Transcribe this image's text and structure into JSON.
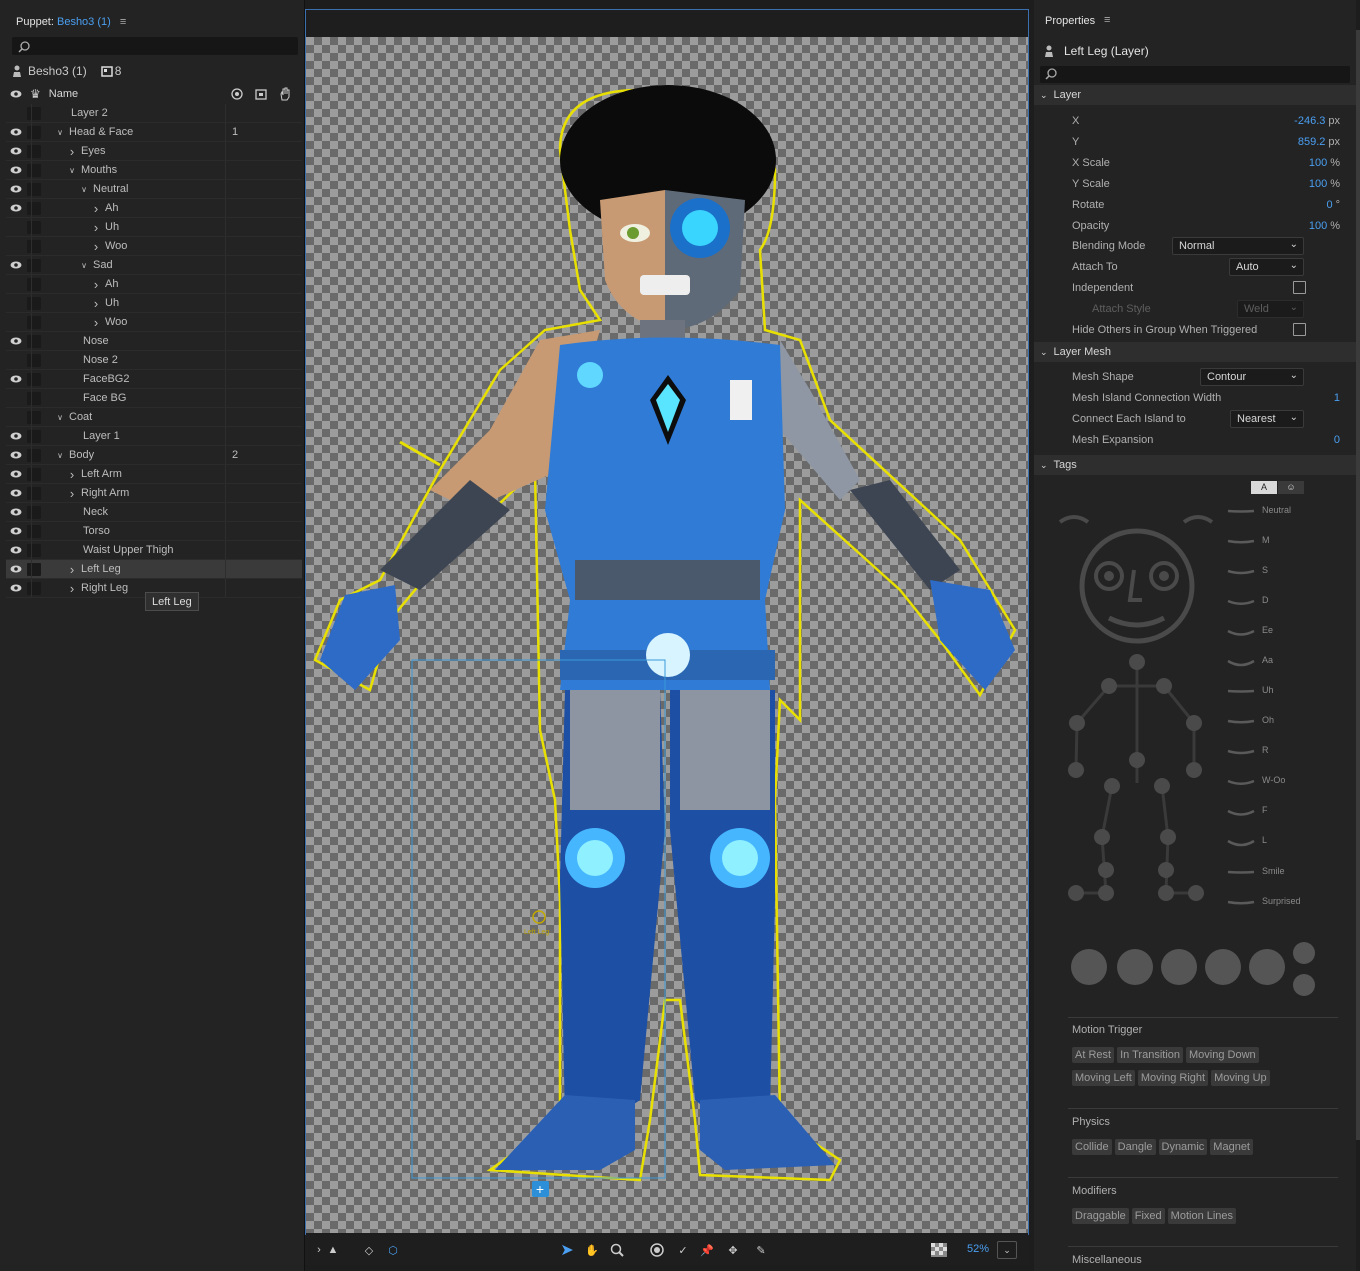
{
  "puppet_panel": {
    "title_prefix": "Puppet:",
    "title_name": "Besho3 (1)",
    "menu_icon": "hamburger-icon",
    "puppet_name": "Besho3 (1)",
    "layer_count": "8",
    "col_name": "Name"
  },
  "tree": [
    {
      "label": "Layer 2",
      "eye": false,
      "indent": 0,
      "chev": ""
    },
    {
      "label": "Head & Face",
      "eye": true,
      "indent": 0,
      "chev": "v",
      "num": "1"
    },
    {
      "label": "Eyes",
      "eye": true,
      "indent": 1,
      "chev": ">"
    },
    {
      "label": "Mouths",
      "eye": true,
      "indent": 1,
      "chev": "v"
    },
    {
      "label": "Neutral",
      "eye": true,
      "indent": 2,
      "chev": "v"
    },
    {
      "label": "Ah",
      "eye": true,
      "indent": 3,
      "chev": ">"
    },
    {
      "label": "Uh",
      "eye": false,
      "indent": 3,
      "chev": ">"
    },
    {
      "label": "Woo",
      "eye": false,
      "indent": 3,
      "chev": ">"
    },
    {
      "label": "Sad",
      "eye": true,
      "indent": 2,
      "chev": "v"
    },
    {
      "label": "Ah",
      "eye": false,
      "indent": 3,
      "chev": ">"
    },
    {
      "label": "Uh",
      "eye": false,
      "indent": 3,
      "chev": ">"
    },
    {
      "label": "Woo",
      "eye": false,
      "indent": 3,
      "chev": ">"
    },
    {
      "label": "Nose",
      "eye": true,
      "indent": 1,
      "chev": ""
    },
    {
      "label": "Nose 2",
      "eye": false,
      "indent": 1,
      "chev": ""
    },
    {
      "label": "FaceBG2",
      "eye": true,
      "indent": 1,
      "chev": ""
    },
    {
      "label": "Face BG",
      "eye": false,
      "indent": 1,
      "chev": ""
    },
    {
      "label": "Coat",
      "eye": false,
      "indent": 0,
      "chev": "v"
    },
    {
      "label": "Layer 1",
      "eye": true,
      "indent": 1,
      "chev": ""
    },
    {
      "label": "Body",
      "eye": true,
      "indent": 0,
      "chev": "v",
      "num": "2"
    },
    {
      "label": "Left Arm",
      "eye": true,
      "indent": 1,
      "chev": ">"
    },
    {
      "label": "Right Arm",
      "eye": true,
      "indent": 1,
      "chev": ">"
    },
    {
      "label": "Neck",
      "eye": true,
      "indent": 1,
      "chev": ""
    },
    {
      "label": "Torso",
      "eye": true,
      "indent": 1,
      "chev": ""
    },
    {
      "label": "Waist Upper Thigh",
      "eye": true,
      "indent": 1,
      "chev": ""
    },
    {
      "label": "Left Leg",
      "eye": true,
      "indent": 1,
      "chev": ">",
      "selected": true
    },
    {
      "label": "Right Leg",
      "eye": true,
      "indent": 1,
      "chev": ">"
    }
  ],
  "tooltip": "Left Leg",
  "canvas": {
    "handle_label": "Left Leg",
    "zoom": "52%"
  },
  "properties": {
    "title": "Properties",
    "layer_title": "Left Leg (Layer)",
    "section_layer": "Layer",
    "rows": [
      {
        "label": "X",
        "value": "-246.3",
        "unit": "px"
      },
      {
        "label": "Y",
        "value": "859.2",
        "unit": "px"
      },
      {
        "label": "X Scale",
        "value": "100",
        "unit": "%"
      },
      {
        "label": "Y Scale",
        "value": "100",
        "unit": "%"
      },
      {
        "label": "Rotate",
        "value": "0",
        "unit": "°"
      },
      {
        "label": "Opacity",
        "value": "100",
        "unit": "%"
      }
    ],
    "blending_mode_label": "Blending Mode",
    "blending_mode": "Normal",
    "attach_to_label": "Attach To",
    "attach_to": "Auto",
    "independent_label": "Independent",
    "attach_style_label": "Attach Style",
    "attach_style": "Weld",
    "hide_others_label": "Hide Others in Group When Triggered",
    "section_mesh": "Layer Mesh",
    "mesh_shape_label": "Mesh Shape",
    "mesh_shape": "Contour",
    "island_width_label": "Mesh Island Connection Width",
    "island_width": "1",
    "connect_label": "Connect Each Island to",
    "connect": "Nearest",
    "expansion_label": "Mesh Expansion",
    "expansion": "0",
    "section_tags": "Tags",
    "tag_tab_a": "A",
    "mouth_tags": [
      "Neutral",
      "M",
      "S",
      "D",
      "Ee",
      "Aa",
      "Uh",
      "Oh",
      "R",
      "W-Oo",
      "F",
      "L",
      "Smile",
      "Surprised"
    ],
    "motion_trigger_label": "Motion Trigger",
    "motion_tags": [
      "At Rest",
      "In Transition",
      "Moving Down",
      "Moving Left",
      "Moving Right",
      "Moving Up"
    ],
    "physics_label": "Physics",
    "physics_tags": [
      "Collide",
      "Dangle",
      "Dynamic",
      "Magnet"
    ],
    "modifiers_label": "Modifiers",
    "modifier_tags": [
      "Draggable",
      "Fixed",
      "Motion Lines"
    ],
    "misc_label": "Miscellaneous"
  },
  "colors": {
    "accent": "#4a9ff2",
    "selection_outline": "#e8e000",
    "panel": "#232323"
  }
}
